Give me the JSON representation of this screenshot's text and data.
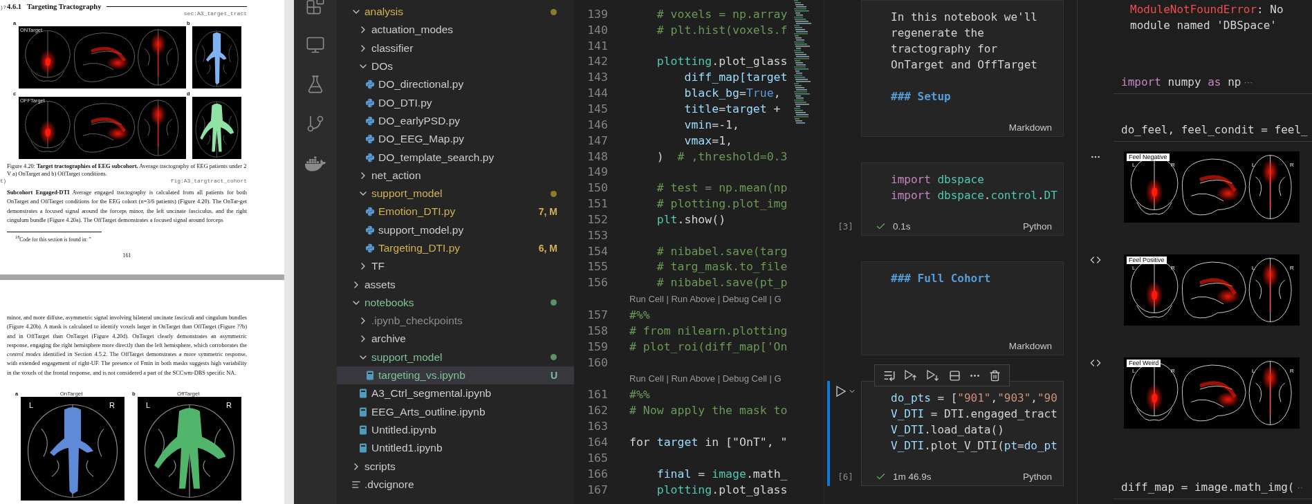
{
  "pdf_viewer": {
    "page_1": {
      "margin_notes": [
        ")?",
        "t)"
      ],
      "section": {
        "number": "4.6.1",
        "title": "Targeting Tractography",
        "label": "sec:A3_target_tract"
      },
      "figure": {
        "panels": [
          {
            "letter": "a",
            "title": "ONTarget",
            "kind": "three-view",
            "color": "#ff1a0a"
          },
          {
            "letter": "b",
            "kind": "axial",
            "color": "#7fb2f0"
          },
          {
            "letter": "c",
            "title": "OFFTarget",
            "kind": "three-view",
            "color": "#ff1a0a"
          },
          {
            "letter": "d",
            "kind": "axial",
            "color": "#8fe3a5"
          }
        ],
        "caption": "Figure 4.20: **Target tractographies of EEG subcohort.** Average tractography of EEG patients under 2 V a) OnTarget and b) OffTarget conditions.",
        "label": "fig:A3_targtract_cohort"
      },
      "paragraph": "**Subcohort Engaged-DTI**   Average engaged tractography is calculated from all patients for both OnTarget and OffTarget conditions for the EEG cohort (n=3/6 patients) (Figure 4.20). The OnTar-get demonstrates a focused signal around the forceps minor, the left uncinate fasciculus, and the right cingulum bundle (Figure 4.20a). The OffTarget demonstrates a focused signal around forceps",
      "footnote": "$^{18}$Code for this section is found in: ”",
      "page_number": "161"
    },
    "page_2": {
      "paragraph": "minor, and more diffuse, asymmetric signal involving bilateral uncinate fasciculi and cingulum bundles (Figure 4.20b). A mask is calculated to identify voxels larger in OnTarget than OffTarget (Figure ??b) and in OffTarget than OnTarget (Figure 4.20d). OnTarget clearly demonstrates an asymmetric response, engaging the right hemisphere more directly than the left hemisphere, which corroborates the *control modes* identified in Section 4.5.2. The OffTarget demonstrates a more symmetric response, with extended engagement of right-UF. The presence of Fmin in both masks suggests high variability in the voxels of the frontal response, and is not considered a part of the SCCwm-DBS specific NA.",
      "figure": {
        "panels": [
          {
            "letter": "a",
            "title": "OnTarget",
            "color": "#5f8ad8",
            "view_labels": [
              "L",
              "R"
            ]
          },
          {
            "letter": "b",
            "title": "OffTarget",
            "color": "#52b56c",
            "view_labels": [
              "L",
              "R"
            ]
          }
        ]
      }
    }
  },
  "activity_bar": {
    "items": [
      {
        "kind": "extensions"
      },
      {
        "kind": "remote"
      },
      {
        "kind": "testing"
      },
      {
        "kind": "git-graph"
      },
      {
        "kind": "docker"
      }
    ]
  },
  "explorer": {
    "tree": [
      {
        "name": "analysis",
        "kind": "folder",
        "expanded": true,
        "color": "#d2b24f",
        "dot": {
          "color": "#8d7b2a"
        },
        "selected": false,
        "children": [
          {
            "name": "actuation_modes",
            "kind": "folder",
            "expanded": false,
            "color": "#cccccc",
            "selected": false
          },
          {
            "name": "classifier",
            "kind": "folder",
            "expanded": false,
            "color": "#cccccc",
            "selected": false
          },
          {
            "name": "DOs",
            "kind": "folder",
            "expanded": true,
            "color": "#cccccc",
            "selected": false,
            "children": [
              {
                "name": "DO_directional.py",
                "kind": "python",
                "color": "#cccccc",
                "selected": false
              },
              {
                "name": "DO_DTI.py",
                "kind": "python",
                "color": "#cccccc",
                "selected": false
              },
              {
                "name": "DO_earlyPSD.py",
                "kind": "python",
                "color": "#cccccc",
                "selected": false
              },
              {
                "name": "DO_EEG_Map.py",
                "kind": "python",
                "color": "#cccccc",
                "selected": false
              },
              {
                "name": "DO_template_search.py",
                "kind": "python",
                "color": "#cccccc",
                "selected": false
              }
            ]
          },
          {
            "name": "net_action",
            "kind": "folder",
            "expanded": false,
            "color": "#cccccc",
            "selected": false
          },
          {
            "name": "support_model",
            "kind": "folder",
            "expanded": true,
            "color": "#d2b24f",
            "dot": {
              "color": "#8d7b2a"
            },
            "selected": false,
            "children": [
              {
                "name": "Emotion_DTI.py",
                "kind": "python",
                "color": "#d2b24f",
                "badge": "7, M",
                "selected": false
              },
              {
                "name": "support_model.py",
                "kind": "python",
                "color": "#cccccc",
                "selected": false
              },
              {
                "name": "Targeting_DTI.py",
                "kind": "python",
                "color": "#d2b24f",
                "badge": "6, M",
                "selected": false
              }
            ]
          },
          {
            "name": "TF",
            "kind": "folder",
            "expanded": false,
            "color": "#cccccc",
            "selected": false
          }
        ]
      },
      {
        "name": "assets",
        "kind": "folder",
        "expanded": false,
        "color": "#cccccc",
        "selected": false
      },
      {
        "name": "notebooks",
        "kind": "folder",
        "expanded": true,
        "color": "#7fc196",
        "dot": {
          "color": "#5c9065"
        },
        "selected": false,
        "children": [
          {
            "name": ".ipynb_checkpoints",
            "kind": "folder",
            "expanded": false,
            "color": "#8c8c8c",
            "selected": false
          },
          {
            "name": "archive",
            "kind": "folder",
            "expanded": false,
            "color": "#cccccc",
            "selected": false
          },
          {
            "name": "support_model",
            "kind": "folder",
            "expanded": true,
            "color": "#7fc196",
            "dot": {
              "color": "#5c9065"
            },
            "selected": false,
            "children": [
              {
                "name": "targeting_vs.ipynb",
                "kind": "notebook",
                "color": "#7fc196",
                "badge": "U",
                "selected": true
              }
            ]
          },
          {
            "name": "A3_Ctrl_segmental.ipynb",
            "kind": "notebook",
            "color": "#cccccc",
            "selected": false
          },
          {
            "name": "EEG_Arts_outline.ipynb",
            "kind": "notebook",
            "color": "#cccccc",
            "selected": false
          },
          {
            "name": "Untitled.ipynb",
            "kind": "notebook",
            "color": "#cccccc",
            "selected": false
          },
          {
            "name": "Untitled1.ipynb",
            "kind": "notebook",
            "color": "#cccccc",
            "selected": false
          }
        ]
      },
      {
        "name": "scripts",
        "kind": "folder",
        "expanded": false,
        "color": "#cccccc",
        "selected": false
      },
      {
        "name": ".dvcignore",
        "kind": "text",
        "color": "#cccccc",
        "selected": false
      }
    ]
  },
  "editor": {
    "lines": [
      {
        "kind": "code",
        "number": "139",
        "tokens": [
          {
            "kind": "comment",
            "text": "    # voxels = np.array"
          }
        ]
      },
      {
        "kind": "code",
        "number": "140",
        "tokens": [
          {
            "kind": "comment",
            "text": "    # plt.hist(voxels.f"
          }
        ]
      },
      {
        "kind": "code",
        "number": "141"
      },
      {
        "kind": "code",
        "number": "142",
        "tokens": [
          {
            "kind": "module",
            "text": "    plotting"
          },
          {
            "kind": "plain",
            "text": ".plot_glass"
          }
        ]
      },
      {
        "kind": "code",
        "number": "143",
        "tokens": [
          {
            "kind": "variable",
            "text": "        diff_map[target"
          }
        ]
      },
      {
        "kind": "code",
        "number": "144",
        "tokens": [
          {
            "kind": "variable",
            "text": "        black_bg"
          },
          {
            "kind": "plain",
            "text": "="
          },
          {
            "kind": "constant",
            "text": "True"
          },
          {
            "kind": "plain",
            "text": ","
          }
        ]
      },
      {
        "kind": "code",
        "number": "145",
        "tokens": [
          {
            "kind": "variable",
            "text": "        title"
          },
          {
            "kind": "plain",
            "text": "="
          },
          {
            "kind": "variable",
            "text": "target"
          },
          {
            "kind": "plain",
            "text": " +"
          }
        ]
      },
      {
        "kind": "code",
        "number": "146",
        "tokens": [
          {
            "kind": "variable",
            "text": "        vmin"
          },
          {
            "kind": "plain",
            "text": "=-1,"
          }
        ]
      },
      {
        "kind": "code",
        "number": "147",
        "tokens": [
          {
            "kind": "variable",
            "text": "        vmax"
          },
          {
            "kind": "plain",
            "text": "=1,"
          }
        ]
      },
      {
        "kind": "code",
        "number": "148",
        "tokens": [
          {
            "kind": "plain",
            "text": "    )  "
          },
          {
            "kind": "comment",
            "text": "# ,threshold=0.3"
          }
        ]
      },
      {
        "kind": "code",
        "number": "149"
      },
      {
        "kind": "code",
        "number": "150",
        "tokens": [
          {
            "kind": "comment",
            "text": "    # test = np.mean(np"
          }
        ]
      },
      {
        "kind": "code",
        "number": "151",
        "tokens": [
          {
            "kind": "comment",
            "text": "    # plotting.plot_img"
          }
        ]
      },
      {
        "kind": "code",
        "number": "152",
        "tokens": [
          {
            "kind": "module",
            "text": "    plt"
          },
          {
            "kind": "plain",
            "text": ".show()"
          }
        ]
      },
      {
        "kind": "code",
        "number": "153"
      },
      {
        "kind": "code",
        "number": "154",
        "tokens": [
          {
            "kind": "comment",
            "text": "    # nibabel.save(targ"
          }
        ]
      },
      {
        "kind": "code",
        "number": "155",
        "tokens": [
          {
            "kind": "comment",
            "text": "    # targ_mask.to_file"
          }
        ]
      },
      {
        "kind": "code",
        "number": "156",
        "tokens": [
          {
            "kind": "comment",
            "text": "    # nibabel.save(pt_p"
          }
        ]
      },
      {
        "kind": "codelens",
        "text": "Run Cell | Run Above | Debug Cell | G"
      },
      {
        "kind": "code",
        "number": "157",
        "tokens": [
          {
            "kind": "comment",
            "text": "#%%"
          }
        ]
      },
      {
        "kind": "code",
        "number": "158",
        "tokens": [
          {
            "kind": "comment",
            "text": "# from nilearn.plotting"
          }
        ]
      },
      {
        "kind": "code",
        "number": "159",
        "tokens": [
          {
            "kind": "comment",
            "text": "# plot_roi(diff_map['On"
          }
        ]
      },
      {
        "kind": "code",
        "number": "160"
      },
      {
        "kind": "codelens",
        "text": "Run Cell | Run Above | Debug Cell | G"
      },
      {
        "kind": "code",
        "number": "161",
        "tokens": [
          {
            "kind": "comment",
            "text": "#%%"
          }
        ]
      },
      {
        "kind": "code",
        "number": "162",
        "tokens": [
          {
            "kind": "comment",
            "text": "# Now apply the mask to"
          }
        ]
      },
      {
        "kind": "code",
        "number": "163"
      },
      {
        "kind": "code",
        "number": "164",
        "tokens": [
          {
            "kind": "plain",
            "text": "for "
          },
          {
            "kind": "variable",
            "text": "target"
          },
          {
            "kind": "plain",
            "text": " in [\"OnT\", \""
          }
        ]
      },
      {
        "kind": "code",
        "number": "165"
      },
      {
        "kind": "code",
        "number": "166",
        "tokens": [
          {
            "kind": "variable",
            "text": "    final"
          },
          {
            "kind": "plain",
            "text": " = "
          },
          {
            "kind": "module",
            "text": "image"
          },
          {
            "kind": "plain",
            "text": ".math_"
          }
        ]
      },
      {
        "kind": "code",
        "number": "167",
        "tokens": [
          {
            "kind": "module",
            "text": "    plotting"
          },
          {
            "kind": "plain",
            "text": ".plot_glass"
          }
        ]
      }
    ]
  },
  "notebook": {
    "cells": [
      {
        "kind": "markdown",
        "language": "Markdown",
        "focused": false,
        "lines": [
          {
            "kind": "text",
            "text": "In this notebook we'll"
          },
          {
            "kind": "text",
            "text": "regenerate the"
          },
          {
            "kind": "text",
            "text": "tractography for"
          },
          {
            "kind": "text",
            "text": "OnTarget and OffTarget"
          },
          {
            "kind": "blank"
          },
          {
            "kind": "heading",
            "text": "### Setup"
          }
        ]
      },
      {
        "kind": "code",
        "language": "Python",
        "focused": false,
        "execution_count": "[3]",
        "succeeded": true,
        "duration": "0.1s",
        "lines": [
          {
            "tokens": [
              {
                "kind": "keyword",
                "text": "import"
              },
              {
                "kind": "module",
                "text": " dbspace"
              }
            ]
          },
          {
            "tokens": [
              {
                "kind": "keyword",
                "text": "import"
              },
              {
                "kind": "module",
                "text": " dbspace"
              },
              {
                "kind": "plain",
                "text": "."
              },
              {
                "kind": "module",
                "text": "control"
              },
              {
                "kind": "plain",
                "text": "."
              },
              {
                "kind": "module",
                "text": "DT"
              }
            ]
          }
        ]
      },
      {
        "kind": "markdown",
        "language": "Markdown",
        "focused": false,
        "lines": [
          {
            "kind": "heading",
            "text": "### Full Cohort"
          }
        ]
      },
      {
        "kind": "code",
        "language": "Python",
        "focused": true,
        "execution_count": "[6]",
        "succeeded": true,
        "duration": "1m 46.9s",
        "lines": [
          {
            "tokens": [
              {
                "kind": "variable",
                "text": "do_pts"
              },
              {
                "kind": "plain",
                "text": " = ["
              },
              {
                "kind": "string",
                "text": "\"901\""
              },
              {
                "kind": "plain",
                "text": ","
              },
              {
                "kind": "string",
                "text": "\"903\""
              },
              {
                "kind": "plain",
                "text": ","
              },
              {
                "kind": "string",
                "text": "\"90"
              }
            ]
          },
          {
            "tokens": [
              {
                "kind": "variable",
                "text": "V_DTI"
              },
              {
                "kind": "plain",
                "text": " = DTI.engaged_tract"
              }
            ]
          },
          {
            "tokens": [
              {
                "kind": "variable",
                "text": "V_DTI"
              },
              {
                "kind": "plain",
                "text": ".load_data()"
              }
            ]
          },
          {
            "tokens": [
              {
                "kind": "variable",
                "text": "V_DTI"
              },
              {
                "kind": "plain",
                "text": ".plot_V_DTI("
              },
              {
                "kind": "variable",
                "text": "pt"
              },
              {
                "kind": "plain",
                "text": "="
              },
              {
                "kind": "variable",
                "text": "do_pt"
              }
            ]
          }
        ]
      }
    ],
    "toolbar": {
      "items": [
        {
          "kind": "run-by-line"
        },
        {
          "kind": "run-above"
        },
        {
          "kind": "run-below"
        },
        {
          "kind": "split"
        },
        {
          "kind": "more"
        },
        {
          "kind": "delete"
        }
      ]
    }
  },
  "interactive_window": {
    "items": [
      {
        "kind": "error",
        "name": "ModuleNotFoundError",
        "message": ": No module named 'DBSpace'"
      },
      {
        "kind": "input",
        "tokens": [
          {
            "kind": "keyword",
            "text": "import"
          },
          {
            "kind": "plain",
            "text": " numpy "
          },
          {
            "kind": "keyword",
            "text": "as"
          },
          {
            "kind": "plain",
            "text": " np"
          }
        ],
        "fold_marker": "···"
      },
      {
        "kind": "input",
        "tokens": [
          {
            "kind": "plain",
            "text": "do_feel, feel_condit = feel_"
          }
        ]
      },
      {
        "kind": "image",
        "title": "Feel Negative",
        "gutter": {
          "kind": "more"
        },
        "view_labels": [
          "L",
          "R",
          "L",
          "R"
        ]
      },
      {
        "kind": "image",
        "title": "Feel Positive",
        "gutter": {
          "kind": "code"
        },
        "view_labels": [
          "L",
          "R",
          "L",
          "R"
        ]
      },
      {
        "kind": "image",
        "title": "Feel Weird",
        "gutter": {
          "kind": "code"
        },
        "view_labels": [
          "L",
          "R",
          "L",
          "R"
        ]
      },
      {
        "kind": "input",
        "tokens": [
          {
            "kind": "plain",
            "text": "diff_map = image.math_img("
          }
        ],
        "fold_marker": "··"
      }
    ]
  }
}
